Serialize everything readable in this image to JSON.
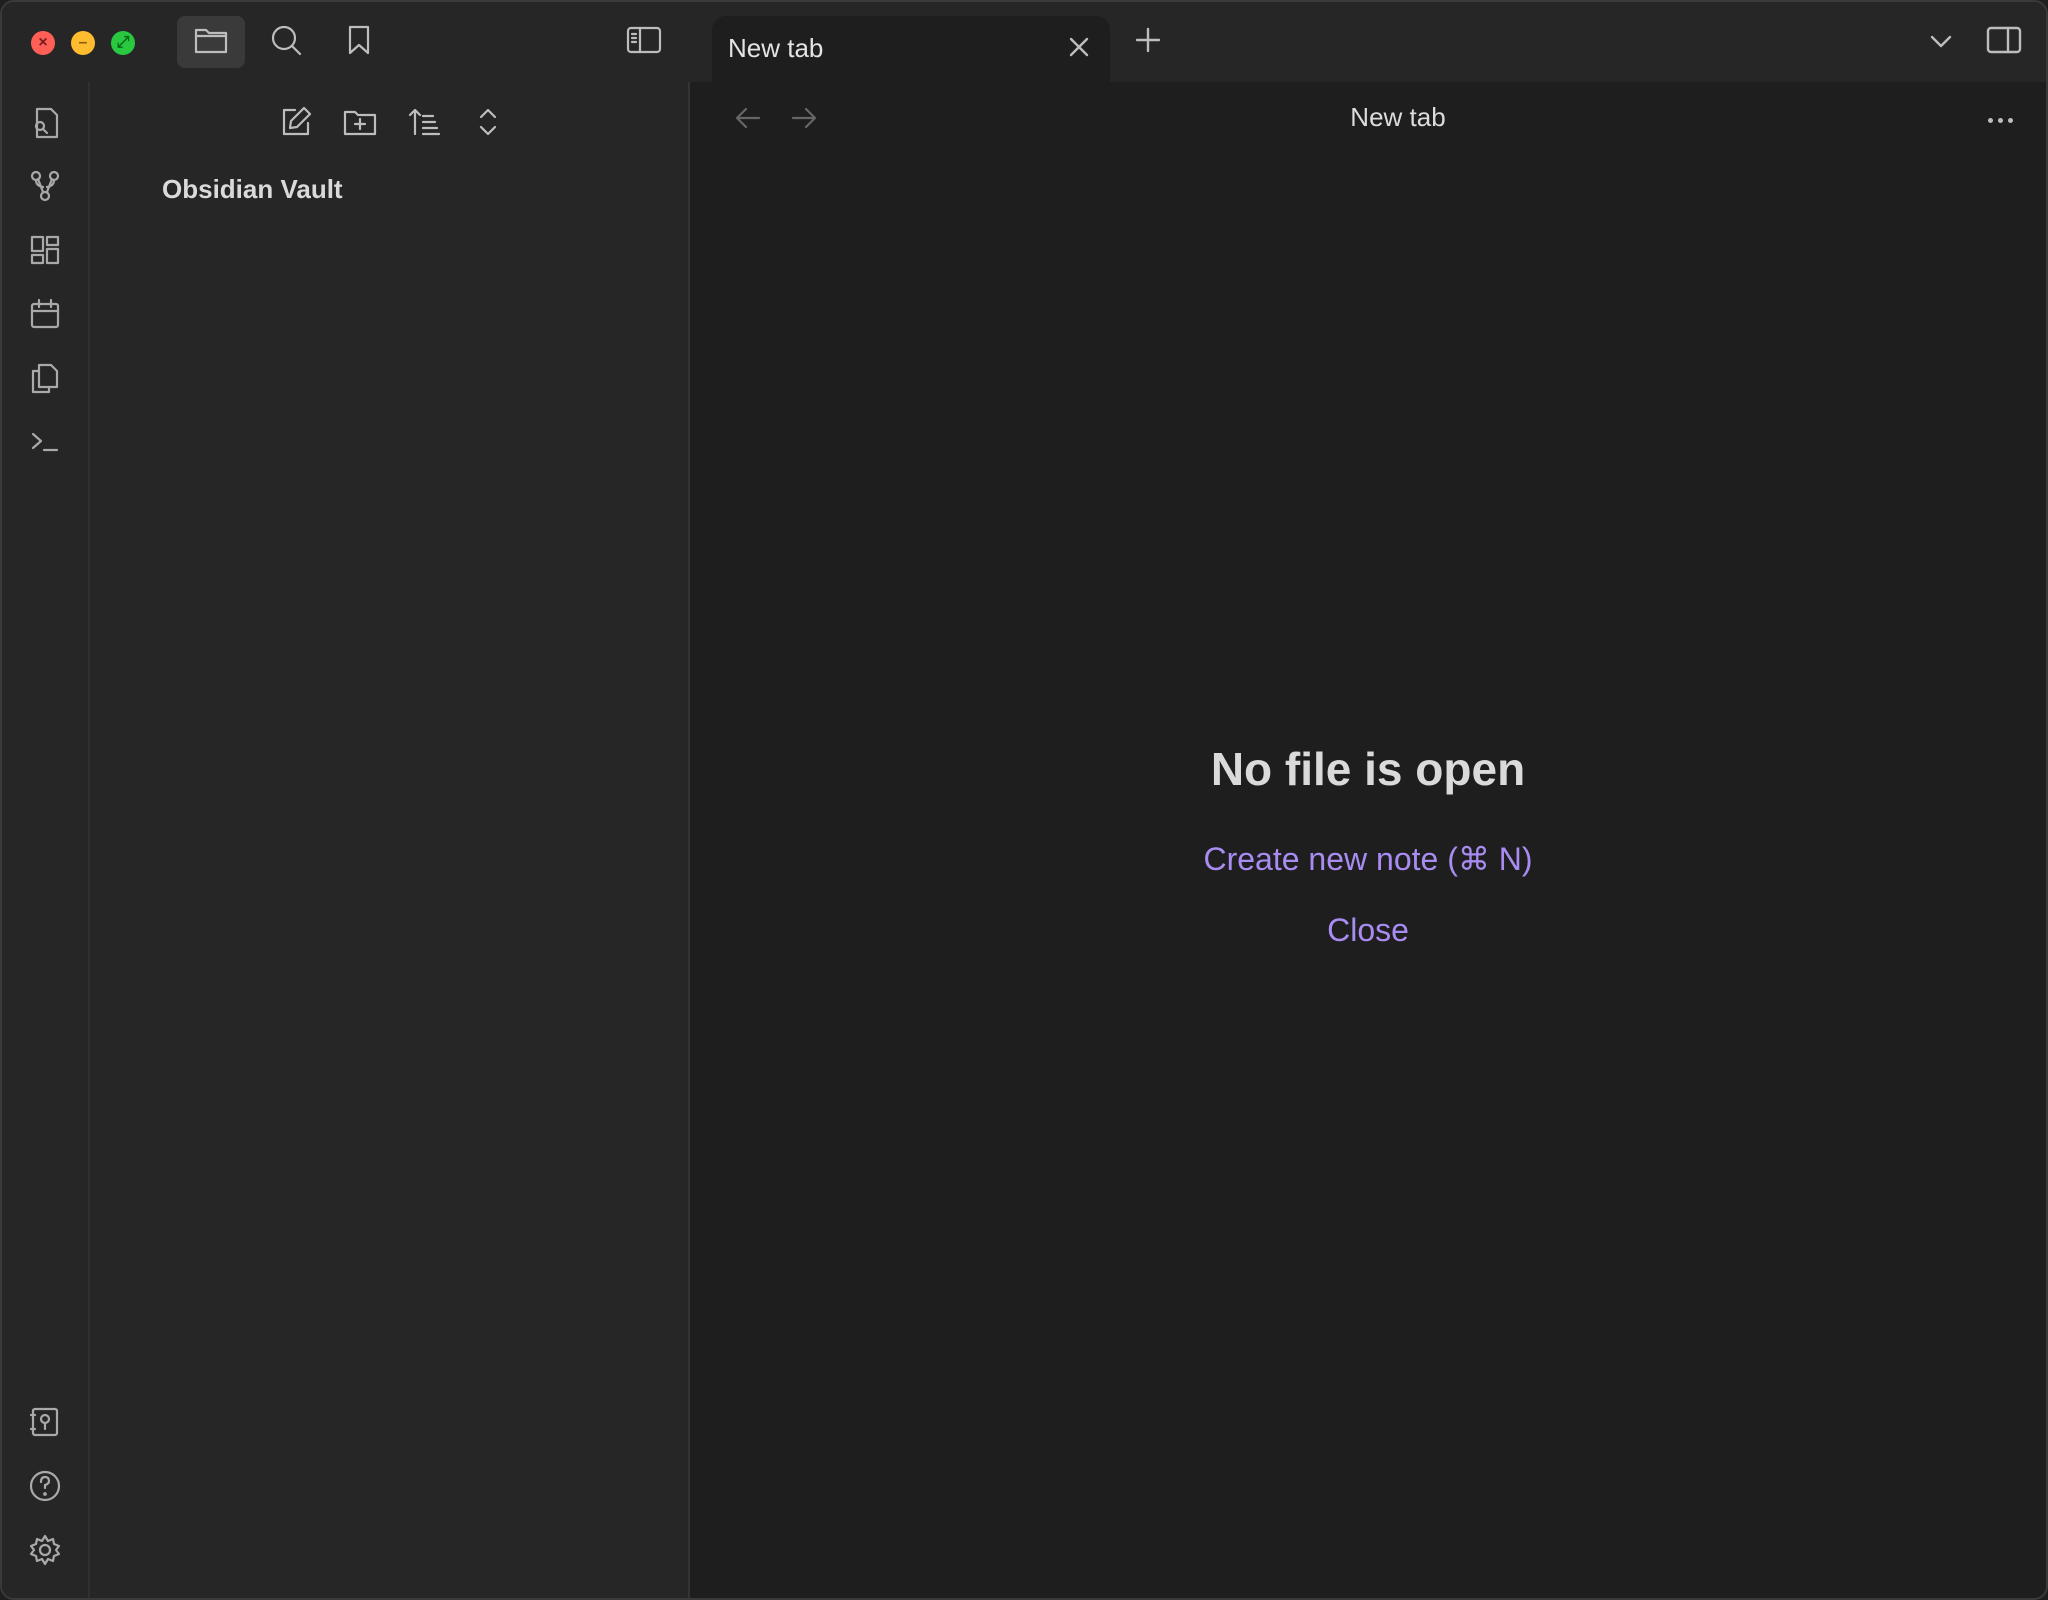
{
  "window": {
    "controls": [
      "close",
      "minimize",
      "maximize"
    ]
  },
  "titlebar": {
    "left_buttons": [
      {
        "name": "files",
        "icon": "folder-icon",
        "active": true
      },
      {
        "name": "search",
        "icon": "search-icon",
        "active": false
      },
      {
        "name": "bookmarks",
        "icon": "bookmark-icon",
        "active": false
      }
    ],
    "sidebar_toggle_icon": "sidebar-left-icon"
  },
  "tabs": [
    {
      "label": "New tab",
      "active": true
    }
  ],
  "ribbon": {
    "top_icons": [
      "quick-switcher-icon",
      "graph-view-icon",
      "canvas-icon",
      "daily-note-icon",
      "templates-icon",
      "command-palette-icon"
    ],
    "bottom_icons": [
      "vault-switcher-icon",
      "help-icon",
      "settings-icon"
    ]
  },
  "file_explorer": {
    "toolbar": [
      "new-note-icon",
      "new-folder-icon",
      "sort-icon",
      "collapse-all-icon"
    ],
    "vault_name": "Obsidian Vault"
  },
  "main": {
    "header_title": "New tab",
    "empty_state": {
      "title": "No file is open",
      "create_note": "Create new note (⌘ N)",
      "close": "Close"
    }
  },
  "colors": {
    "accent": "#a98cf2",
    "background": "#1e1e1e",
    "sidebar": "#262626"
  }
}
